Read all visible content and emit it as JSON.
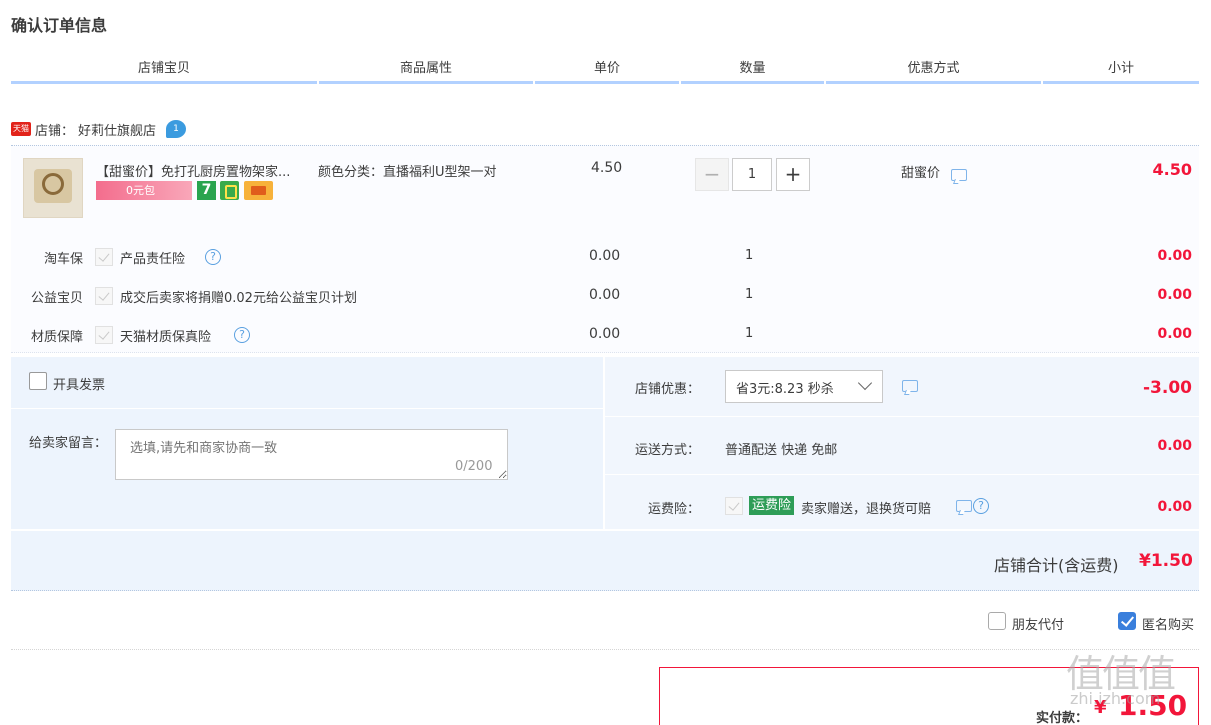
{
  "page_title": "确认订单信息",
  "columns": [
    "店铺宝贝",
    "商品属性",
    "单价",
    "数量",
    "优惠方式",
    "小计"
  ],
  "shop": {
    "badge": "天猫",
    "prefix": "店铺：",
    "name": "好莉仕旗舰店",
    "ww": "1"
  },
  "item": {
    "title": "【甜蜜价】免打孔厨房置物架家...",
    "tag_pink": "0元包",
    "tag_7": "7",
    "sku": "颜色分类：直播福利U型架一对",
    "unit_price": "4.50",
    "quantity": "1",
    "promo": "甜蜜价",
    "subtotal": "4.50"
  },
  "services": [
    {
      "label": "淘车保",
      "name": "产品责任险",
      "price": "0.00",
      "qty": "1",
      "subtotal": "0.00",
      "help": true
    },
    {
      "label": "公益宝贝",
      "name": "成交后卖家将捐赠0.02元给公益宝贝计划",
      "price": "0.00",
      "qty": "1",
      "subtotal": "0.00",
      "help": false
    },
    {
      "label": "材质保障",
      "name": "天猫材质保真险",
      "price": "0.00",
      "qty": "1",
      "subtotal": "0.00",
      "help": true
    }
  ],
  "invoice_label": "开具发票",
  "message": {
    "label": "给卖家留言：",
    "placeholder": "选填,请先和商家协商一致",
    "count": "0/200"
  },
  "shop_discount": {
    "label": "店铺优惠：",
    "selected": "省3元:8.23 秒杀",
    "amount": "-3.00"
  },
  "shipping": {
    "label": "运送方式：",
    "value": "普通配送 快递 免邮",
    "amount": "0.00"
  },
  "freight_insurance": {
    "label": "运费险：",
    "badge": "运费险",
    "text": "卖家赠送，退换货可赔",
    "amount": "0.00"
  },
  "shop_total": {
    "label": "店铺合计(含运费)",
    "value": "¥1.50"
  },
  "options": {
    "friend_pay": "朋友代付",
    "anonymous": "匿名购买"
  },
  "payment": {
    "label": "实付款：",
    "symbol": "¥",
    "value": "1.50"
  },
  "watermark": {
    "logo": "值值值",
    "site": "zhi.izh.com"
  },
  "colors": {
    "accent_red": "#f2163a",
    "header_line": "#b2d1ff",
    "panel_bg": "#edf4fd",
    "check_blue": "#3a7fdc"
  }
}
